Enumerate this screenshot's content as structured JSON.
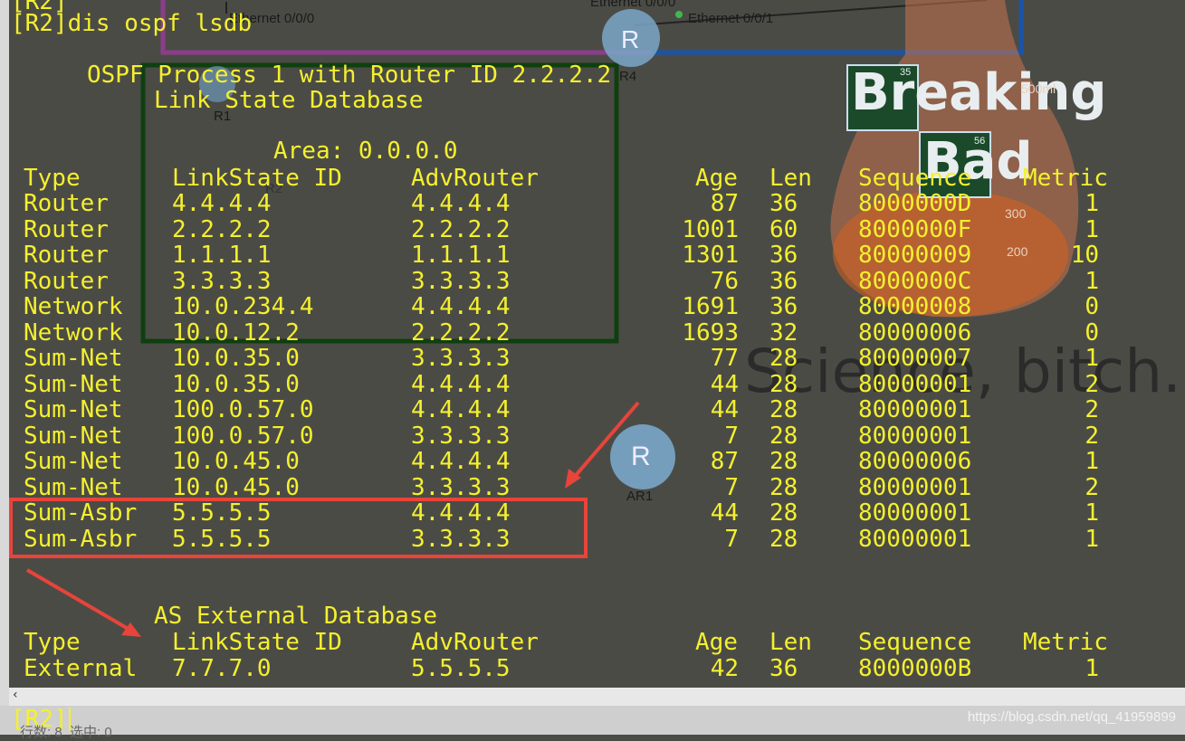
{
  "terminal": {
    "prompt_top": "[R2]",
    "command": "[R2]dis ospf lsdb",
    "process_line": "OSPF Process 1 with Router ID 2.2.2.2",
    "lsdb_title": "Link State Database",
    "area_line": "Area: 0.0.0.0",
    "headers": {
      "type": "Type",
      "linkstate_id": "LinkState ID",
      "advrouter": "AdvRouter",
      "age": "Age",
      "len": "Len",
      "sequence": "Sequence",
      "metric": "Metric"
    },
    "rows": [
      {
        "type": "Router",
        "lsid": "4.4.4.4",
        "adv": "4.4.4.4",
        "age": "87",
        "len": "36",
        "seq": "8000000D",
        "metric": "1"
      },
      {
        "type": "Router",
        "lsid": "2.2.2.2",
        "adv": "2.2.2.2",
        "age": "1001",
        "len": "60",
        "seq": "8000000F",
        "metric": "1"
      },
      {
        "type": "Router",
        "lsid": "1.1.1.1",
        "adv": "1.1.1.1",
        "age": "1301",
        "len": "36",
        "seq": "80000009",
        "metric": "10"
      },
      {
        "type": "Router",
        "lsid": "3.3.3.3",
        "adv": "3.3.3.3",
        "age": "76",
        "len": "36",
        "seq": "8000000C",
        "metric": "1"
      },
      {
        "type": "Network",
        "lsid": "10.0.234.4",
        "adv": "4.4.4.4",
        "age": "1691",
        "len": "36",
        "seq": "80000008",
        "metric": "0"
      },
      {
        "type": "Network",
        "lsid": "10.0.12.2",
        "adv": "2.2.2.2",
        "age": "1693",
        "len": "32",
        "seq": "80000006",
        "metric": "0"
      },
      {
        "type": "Sum-Net",
        "lsid": "10.0.35.0",
        "adv": "3.3.3.3",
        "age": "77",
        "len": "28",
        "seq": "80000007",
        "metric": "1"
      },
      {
        "type": "Sum-Net",
        "lsid": "10.0.35.0",
        "adv": "4.4.4.4",
        "age": "44",
        "len": "28",
        "seq": "80000001",
        "metric": "2"
      },
      {
        "type": "Sum-Net",
        "lsid": "100.0.57.0",
        "adv": "4.4.4.4",
        "age": "44",
        "len": "28",
        "seq": "80000001",
        "metric": "2"
      },
      {
        "type": "Sum-Net",
        "lsid": "100.0.57.0",
        "adv": "3.3.3.3",
        "age": "7",
        "len": "28",
        "seq": "80000001",
        "metric": "2"
      },
      {
        "type": "Sum-Net",
        "lsid": "10.0.45.0",
        "adv": "4.4.4.4",
        "age": "87",
        "len": "28",
        "seq": "80000006",
        "metric": "1"
      },
      {
        "type": "Sum-Net",
        "lsid": "10.0.45.0",
        "adv": "3.3.3.3",
        "age": "7",
        "len": "28",
        "seq": "80000001",
        "metric": "2"
      },
      {
        "type": "Sum-Asbr",
        "lsid": "5.5.5.5",
        "adv": "4.4.4.4",
        "age": "44",
        "len": "28",
        "seq": "80000001",
        "metric": "1"
      },
      {
        "type": "Sum-Asbr",
        "lsid": "5.5.5.5",
        "adv": "3.3.3.3",
        "age": "7",
        "len": "28",
        "seq": "80000001",
        "metric": "1"
      }
    ],
    "ext_title": "AS External Database",
    "ext_rows": [
      {
        "type": "External",
        "lsid": "7.7.7.0",
        "adv": "5.5.5.5",
        "age": "42",
        "len": "36",
        "seq": "8000000B",
        "metric": "1"
      }
    ],
    "prompt_bottom": "[R2]"
  },
  "background": {
    "label_eth_000": "Ethernet 0/0/0",
    "label_eth_000_top": "Ethernet 0/0/0",
    "label_eth_001": "Ethernet 0/0/1",
    "router_letter": "R",
    "label_r1": "R1",
    "label_r4": "R4",
    "label_ar1": "AR1",
    "label_r2_partial": "R2",
    "breaking": "Breaking",
    "bad": "Bad",
    "br_num": "35",
    "ba_num": "56",
    "science": "Science, bitch.",
    "flask_500": "500ml",
    "flask_300": "300",
    "flask_200": "200"
  },
  "status": {
    "left_text": "行数: 8  选中: 0",
    "watermark": "https://blog.csdn.net/qq_41959899"
  },
  "colors": {
    "terminal_text": "#f4f02e",
    "background": "#4b4b46",
    "highlight_box": "#e8443a",
    "green_box": "#0f3f0f"
  }
}
